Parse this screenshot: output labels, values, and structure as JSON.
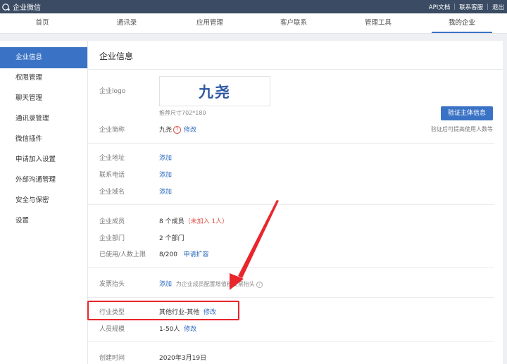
{
  "topbar": {
    "brand": "企业微信",
    "links": [
      "API文档",
      "联系客服",
      "退出"
    ]
  },
  "nav": {
    "tabs": [
      {
        "label": "首页"
      },
      {
        "label": "通讯录"
      },
      {
        "label": "应用管理"
      },
      {
        "label": "客户联系"
      },
      {
        "label": "管理工具"
      },
      {
        "label": "我的企业"
      }
    ],
    "active": "我的企业"
  },
  "sidebar": {
    "items": [
      {
        "label": "企业信息"
      },
      {
        "label": "权限管理"
      },
      {
        "label": "聊天管理"
      },
      {
        "label": "通讯录管理"
      },
      {
        "label": "微信插件"
      },
      {
        "label": "申请加入设置"
      },
      {
        "label": "外部沟通管理"
      },
      {
        "label": "安全与保密"
      },
      {
        "label": "设置"
      }
    ],
    "active": "企业信息"
  },
  "main": {
    "title": "企业信息",
    "logo_label": "企业logo",
    "logo_text": "九尧",
    "logo_tip": "推荐尺寸702*180",
    "verify_button": "验证主体信息",
    "verify_tip": "验证后可提高使用人数等",
    "short_name_label": "企业简称",
    "short_name_value": "九尧",
    "short_name_edit": "修改",
    "address_label": "企业地址",
    "address_action": "添加",
    "phone_label": "联系电话",
    "phone_action": "添加",
    "domain_label": "企业域名",
    "domain_action": "添加",
    "members_label": "企业成员",
    "members_value": "8 个成员",
    "members_unjoined": "（未加入 1人）",
    "depts_label": "企业部门",
    "depts_value": "2 个部门",
    "usage_label": "已使用/人数上限",
    "usage_value": "8/200",
    "usage_action": "申请扩容",
    "invoice_label": "发票抬头",
    "invoice_action": "添加",
    "invoice_hint": "为企业成员配置增值税发票抬头",
    "industry_label": "行业类型",
    "industry_value": "其他行业-其他",
    "industry_edit": "修改",
    "scale_label": "人员规模",
    "scale_value": "1-50人",
    "scale_edit": "修改",
    "created_label": "创建时间",
    "created_value": "2020年3月19日"
  },
  "colors": {
    "topbar": "#3a4b63",
    "accent": "#3a73c5",
    "annotation": "#e8262b"
  }
}
